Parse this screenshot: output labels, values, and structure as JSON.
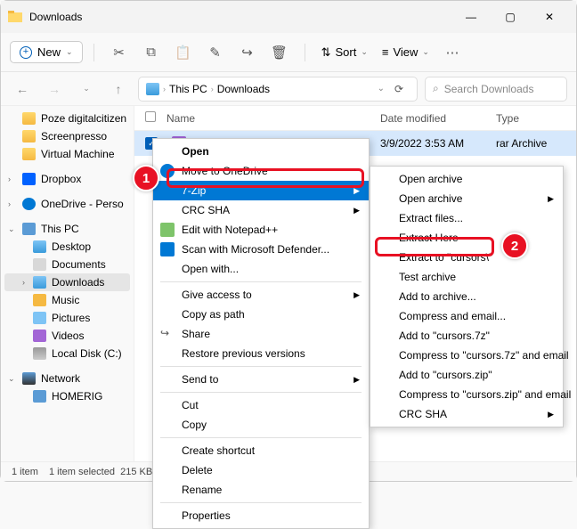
{
  "window": {
    "title": "Downloads"
  },
  "toolbar": {
    "new": "New",
    "sort": "Sort",
    "view": "View"
  },
  "breadcrumb": {
    "a": "This PC",
    "b": "Downloads"
  },
  "search": {
    "placeholder": "Search Downloads"
  },
  "sidebar": {
    "poze": "Poze digitalcitizen",
    "screenpresso": "Screenpresso",
    "vm": "Virtual Machine",
    "dropbox": "Dropbox",
    "onedrive": "OneDrive - Perso",
    "thispc": "This PC",
    "desktop": "Desktop",
    "documents": "Documents",
    "downloads": "Downloads",
    "music": "Music",
    "pictures": "Pictures",
    "videos": "Videos",
    "disk": "Local Disk (C:)",
    "network": "Network",
    "homerig": "HOMERIG"
  },
  "columns": {
    "name": "Name",
    "date": "Date modified",
    "type": "Type"
  },
  "file": {
    "date": "3/9/2022 3:53 AM",
    "type": "rar Archive"
  },
  "ctx1": {
    "open": "Open",
    "move": "Move to OneDrive",
    "sevenzip": "7-Zip",
    "crc": "CRC SHA",
    "notepad": "Edit with Notepad++",
    "defender": "Scan with Microsoft Defender...",
    "openwith": "Open with...",
    "giveaccess": "Give access to",
    "copypath": "Copy as path",
    "share": "Share",
    "restore": "Restore previous versions",
    "sendto": "Send to",
    "cut": "Cut",
    "copy": "Copy",
    "shortcut": "Create shortcut",
    "delete": "Delete",
    "rename": "Rename",
    "properties": "Properties"
  },
  "ctx2": {
    "openarchive": "Open archive",
    "openarchive2": "Open archive",
    "extractfiles": "Extract files...",
    "extracthere": "Extract Here",
    "extractto": "Extract to \"cursors\\\"",
    "test": "Test archive",
    "addarchive": "Add to archive...",
    "compressemail": "Compress and email...",
    "add7z": "Add to \"cursors.7z\"",
    "compress7z": "Compress to \"cursors.7z\" and email",
    "addzip": "Add to \"cursors.zip\"",
    "compresszip": "Compress to \"cursors.zip\" and email",
    "crcsha": "CRC SHA"
  },
  "status": {
    "items": "1 item",
    "selected": "1 item selected",
    "size": "215 KB"
  },
  "badges": {
    "one": "1",
    "two": "2"
  }
}
